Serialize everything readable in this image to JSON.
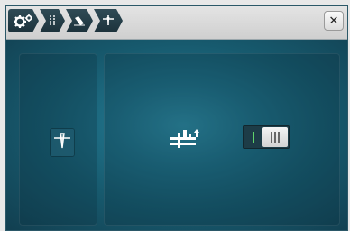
{
  "breadcrumb": {
    "items": [
      {
        "icon": "settings-gears-icon"
      },
      {
        "icon": "stitch-column-icon"
      },
      {
        "icon": "presser-foot-icon"
      },
      {
        "icon": "needle-icon"
      }
    ]
  },
  "header": {
    "close_icon": "close-icon",
    "close_glyph": "✕"
  },
  "left_panel": {
    "button_icon": "needle-position-icon"
  },
  "right_panel": {
    "center_icon": "bobbin-thread-icon",
    "toggle": {
      "left_icon": "single-bar-icon",
      "right_icon": "triple-bar-icon",
      "selected": "right"
    }
  },
  "colors": {
    "accent_green": "#5fd36a",
    "header_bg": "#d9d9d9",
    "content_bg": "#1f6f86"
  }
}
